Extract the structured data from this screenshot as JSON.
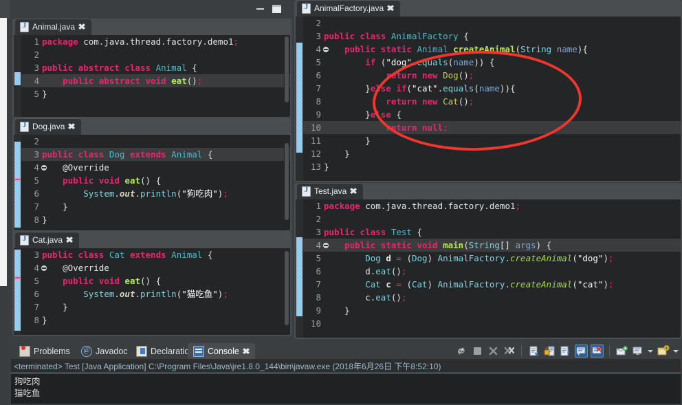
{
  "window": {
    "minimize_label": "minimize",
    "maximize_label": "maximize"
  },
  "editors": {
    "animal": {
      "tab_title": "Animal.java",
      "close_label": "✖",
      "lines": [
        {
          "n": "1",
          "segs": [
            [
              "kw",
              "package"
            ],
            [
              "pl",
              " com"
            ],
            [
              "punc",
              "."
            ],
            [
              "pl",
              "java"
            ],
            [
              "punc",
              "."
            ],
            [
              "pl",
              "thread"
            ],
            [
              "punc",
              "."
            ],
            [
              "pl",
              "factory"
            ],
            [
              "punc",
              "."
            ],
            [
              "pl",
              "demo1"
            ],
            [
              "semi",
              ";"
            ]
          ]
        },
        {
          "n": "2",
          "segs": []
        },
        {
          "n": "3",
          "segs": [
            [
              "kw",
              "public abstract class "
            ],
            [
              "type",
              "Animal"
            ],
            [
              "pl",
              " {"
            ]
          ]
        },
        {
          "n": "4",
          "hl": true,
          "segs": [
            [
              "pl",
              "    "
            ],
            [
              "kw",
              "public abstract void "
            ],
            [
              "mth",
              "eat"
            ],
            [
              "pl",
              "()"
            ],
            [
              "semi",
              ";"
            ]
          ]
        },
        {
          "n": "5",
          "segs": [
            [
              "pl",
              "}"
            ]
          ]
        }
      ]
    },
    "dog": {
      "tab_title": "Dog.java",
      "close_label": "✖",
      "lines": [
        {
          "n": "2",
          "segs": []
        },
        {
          "n": "3",
          "hl": true,
          "segs": [
            [
              "kw",
              "public class "
            ],
            [
              "type",
              "Dog"
            ],
            [
              "pl",
              " "
            ],
            [
              "kw",
              "extends "
            ],
            [
              "type",
              "Animal"
            ],
            [
              "pl",
              " {"
            ]
          ]
        },
        {
          "n": "4",
          "fold": true,
          "segs": [
            [
              "ann",
              "    @Override"
            ]
          ]
        },
        {
          "n": "5",
          "arrow": true,
          "segs": [
            [
              "pl",
              "    "
            ],
            [
              "kw",
              "public void "
            ],
            [
              "mth",
              "eat"
            ],
            [
              "pl",
              "() {"
            ]
          ]
        },
        {
          "n": "6",
          "segs": [
            [
              "pl",
              "        "
            ],
            [
              "type2",
              "System"
            ],
            [
              "punc",
              "."
            ],
            [
              "field",
              "out"
            ],
            [
              "punc",
              "."
            ],
            [
              "type2",
              "println"
            ],
            [
              "pl",
              "("
            ],
            [
              "strq",
              "\"狗吃肉\""
            ],
            [
              "pl",
              ")"
            ],
            [
              "semi",
              ";"
            ]
          ]
        },
        {
          "n": "7",
          "segs": [
            [
              "pl",
              "    }"
            ]
          ]
        },
        {
          "n": "8",
          "segs": [
            [
              "pl",
              "}"
            ]
          ]
        }
      ]
    },
    "cat": {
      "tab_title": "Cat.java",
      "close_label": "✖",
      "lines": [
        {
          "n": "3",
          "segs": [
            [
              "kw",
              "public class "
            ],
            [
              "type",
              "Cat"
            ],
            [
              "pl",
              " "
            ],
            [
              "kw",
              "extends "
            ],
            [
              "type",
              "Animal"
            ],
            [
              "pl",
              " {"
            ]
          ]
        },
        {
          "n": "4",
          "fold": true,
          "segs": [
            [
              "ann",
              "    @Override"
            ]
          ]
        },
        {
          "n": "5",
          "arrow": true,
          "segs": [
            [
              "pl",
              "    "
            ],
            [
              "kw",
              "public void "
            ],
            [
              "mth",
              "eat"
            ],
            [
              "pl",
              "() {"
            ]
          ]
        },
        {
          "n": "6",
          "segs": [
            [
              "pl",
              "        "
            ],
            [
              "type2",
              "System"
            ],
            [
              "punc",
              "."
            ],
            [
              "field",
              "out"
            ],
            [
              "punc",
              "."
            ],
            [
              "type2",
              "println"
            ],
            [
              "pl",
              "("
            ],
            [
              "strq",
              "\"猫吃鱼\""
            ],
            [
              "pl",
              ")"
            ],
            [
              "semi",
              ";"
            ]
          ]
        },
        {
          "n": "7",
          "segs": [
            [
              "pl",
              "    }"
            ]
          ]
        },
        {
          "n": "8",
          "segs": [
            [
              "pl",
              "}"
            ]
          ]
        }
      ]
    },
    "animalfactory": {
      "tab_title": "AnimalFactory.java",
      "close_label": "✖",
      "lines": [
        {
          "n": "2",
          "segs": []
        },
        {
          "n": "3",
          "segs": [
            [
              "kw",
              "public class "
            ],
            [
              "type",
              "AnimalFactory"
            ],
            [
              "pl",
              " {"
            ]
          ]
        },
        {
          "n": "4",
          "fold": true,
          "segs": [
            [
              "pl",
              "    "
            ],
            [
              "kw",
              "public static "
            ],
            [
              "type",
              "Animal"
            ],
            [
              "pl",
              " "
            ],
            [
              "mth",
              "createAnimal"
            ],
            [
              "pl",
              "("
            ],
            [
              "type2",
              "String"
            ],
            [
              "pl",
              " "
            ],
            [
              "param",
              "name"
            ],
            [
              "pl",
              "){"
            ]
          ]
        },
        {
          "n": "5",
          "segs": [
            [
              "pl",
              "        "
            ],
            [
              "kw",
              "if"
            ],
            [
              "pl",
              " ("
            ],
            [
              "strq",
              "\"dog\""
            ],
            [
              "punc",
              "."
            ],
            [
              "type2",
              "equals"
            ],
            [
              "pl",
              "("
            ],
            [
              "param",
              "name"
            ],
            [
              "pl",
              ")) {"
            ]
          ]
        },
        {
          "n": "6",
          "segs": [
            [
              "pl",
              "            "
            ],
            [
              "kw",
              "return new "
            ],
            [
              "yel",
              "Dog"
            ],
            [
              "pl",
              "()"
            ],
            [
              "semi",
              ";"
            ]
          ]
        },
        {
          "n": "7",
          "segs": [
            [
              "pl",
              "        }"
            ],
            [
              "kw",
              "else if"
            ],
            [
              "pl",
              "("
            ],
            [
              "strq",
              "\"cat\""
            ],
            [
              "punc",
              "."
            ],
            [
              "type2",
              "equals"
            ],
            [
              "pl",
              "("
            ],
            [
              "param",
              "name"
            ],
            [
              "pl",
              ")){"
            ]
          ]
        },
        {
          "n": "8",
          "segs": [
            [
              "pl",
              "            "
            ],
            [
              "kw",
              "return new "
            ],
            [
              "yel",
              "Cat"
            ],
            [
              "pl",
              "()"
            ],
            [
              "semi",
              ";"
            ]
          ]
        },
        {
          "n": "9",
          "segs": [
            [
              "pl",
              "        }"
            ],
            [
              "kw",
              "else"
            ],
            [
              "pl",
              " {"
            ]
          ]
        },
        {
          "n": "10",
          "hl": true,
          "segs": [
            [
              "pl",
              "            "
            ],
            [
              "kw",
              "return null"
            ],
            [
              "semi",
              ";"
            ]
          ]
        },
        {
          "n": "11",
          "segs": [
            [
              "pl",
              "        }"
            ]
          ]
        },
        {
          "n": "12",
          "segs": [
            [
              "pl",
              "    }"
            ]
          ]
        },
        {
          "n": "13",
          "segs": [
            [
              "pl",
              "}"
            ]
          ]
        }
      ]
    },
    "test": {
      "tab_title": "Test.java",
      "close_label": "✖",
      "lines": [
        {
          "n": "1",
          "segs": [
            [
              "kw",
              "package"
            ],
            [
              "pl",
              " com"
            ],
            [
              "punc",
              "."
            ],
            [
              "pl",
              "java"
            ],
            [
              "punc",
              "."
            ],
            [
              "pl",
              "thread"
            ],
            [
              "punc",
              "."
            ],
            [
              "pl",
              "factory"
            ],
            [
              "punc",
              "."
            ],
            [
              "pl",
              "demo1"
            ],
            [
              "semi",
              ";"
            ]
          ]
        },
        {
          "n": "2",
          "segs": []
        },
        {
          "n": "3",
          "segs": [
            [
              "kw",
              "public class "
            ],
            [
              "type",
              "Test"
            ],
            [
              "pl",
              " {"
            ]
          ]
        },
        {
          "n": "4",
          "fold": true,
          "hl": true,
          "segs": [
            [
              "pl",
              "    "
            ],
            [
              "kw",
              "public static void "
            ],
            [
              "mth",
              "main"
            ],
            [
              "pl",
              "("
            ],
            [
              "type2",
              "String"
            ],
            [
              "pl",
              "[] "
            ],
            [
              "param",
              "args"
            ],
            [
              "pl",
              ") {"
            ]
          ]
        },
        {
          "n": "5",
          "segs": [
            [
              "pl",
              "        "
            ],
            [
              "type2",
              "Dog"
            ],
            [
              "pl",
              " "
            ],
            [
              "var",
              "d"
            ],
            [
              "pl",
              " "
            ],
            [
              "eq",
              "="
            ],
            [
              "pl",
              " ("
            ],
            [
              "type2",
              "Dog"
            ],
            [
              "pl",
              ") "
            ],
            [
              "type2",
              "AnimalFactory"
            ],
            [
              "punc",
              "."
            ],
            [
              "mthi",
              "createAnimal"
            ],
            [
              "pl",
              "("
            ],
            [
              "strq",
              "\"dog\""
            ],
            [
              "pl",
              ")"
            ],
            [
              "semi",
              ";"
            ]
          ]
        },
        {
          "n": "6",
          "segs": [
            [
              "pl",
              "        "
            ],
            [
              "pl",
              "d"
            ],
            [
              "punc",
              "."
            ],
            [
              "type2",
              "eat"
            ],
            [
              "pl",
              "()"
            ],
            [
              "semi",
              ";"
            ]
          ]
        },
        {
          "n": "7",
          "segs": [
            [
              "pl",
              "        "
            ],
            [
              "type2",
              "Cat"
            ],
            [
              "pl",
              " "
            ],
            [
              "var",
              "c"
            ],
            [
              "pl",
              " "
            ],
            [
              "eq",
              "="
            ],
            [
              "pl",
              " ("
            ],
            [
              "type2",
              "Cat"
            ],
            [
              "pl",
              ") "
            ],
            [
              "type2",
              "AnimalFactory"
            ],
            [
              "punc",
              "."
            ],
            [
              "mthi",
              "createAnimal"
            ],
            [
              "pl",
              "("
            ],
            [
              "strq",
              "\"cat\""
            ],
            [
              "pl",
              ")"
            ],
            [
              "semi",
              ";"
            ]
          ]
        },
        {
          "n": "8",
          "segs": [
            [
              "pl",
              "        "
            ],
            [
              "pl",
              "c"
            ],
            [
              "punc",
              "."
            ],
            [
              "type2",
              "eat"
            ],
            [
              "pl",
              "()"
            ],
            [
              "semi",
              ";"
            ]
          ]
        },
        {
          "n": "9",
          "segs": [
            [
              "pl",
              "    }"
            ]
          ]
        },
        {
          "n": "10",
          "segs": []
        }
      ]
    }
  },
  "annotation": {
    "shape": "ellipse",
    "color": "#f0372e"
  },
  "bottom_panel": {
    "tabs": [
      {
        "label": "Problems",
        "icon": "problems-icon",
        "active": false
      },
      {
        "label": "Javadoc",
        "icon": "javadoc-icon",
        "active": false
      },
      {
        "label": "Declaration",
        "icon": "declaration-icon",
        "active": false
      },
      {
        "label": "Console",
        "icon": "console-icon",
        "active": true,
        "close_label": "✖"
      }
    ],
    "toolbar": [
      {
        "name": "relaunch-icon"
      },
      {
        "name": "terminate-icon"
      },
      {
        "name": "remove-launch-icon"
      },
      {
        "name": "remove-all-terminated-icon"
      },
      {
        "name": "separator"
      },
      {
        "name": "clear-console-icon"
      },
      {
        "name": "scroll-lock-icon"
      },
      {
        "name": "pin-console-icon"
      },
      {
        "name": "display-selected-console-icon"
      },
      {
        "name": "stderr-console-icon"
      },
      {
        "name": "separator"
      },
      {
        "name": "open-console-icon"
      },
      {
        "name": "display-console-icon"
      },
      {
        "name": "display-console-dropdown-icon"
      },
      {
        "name": "new-console-view-icon"
      },
      {
        "name": "new-console-dropdown-icon"
      }
    ],
    "console_header": "<terminated> Test [Java Application] C:\\Program Files\\Java\\jre1.8.0_144\\bin\\javaw.exe (2018年6月26日 下午8:52:10)",
    "console_output": [
      "狗吃肉",
      "猫吃鱼"
    ]
  }
}
